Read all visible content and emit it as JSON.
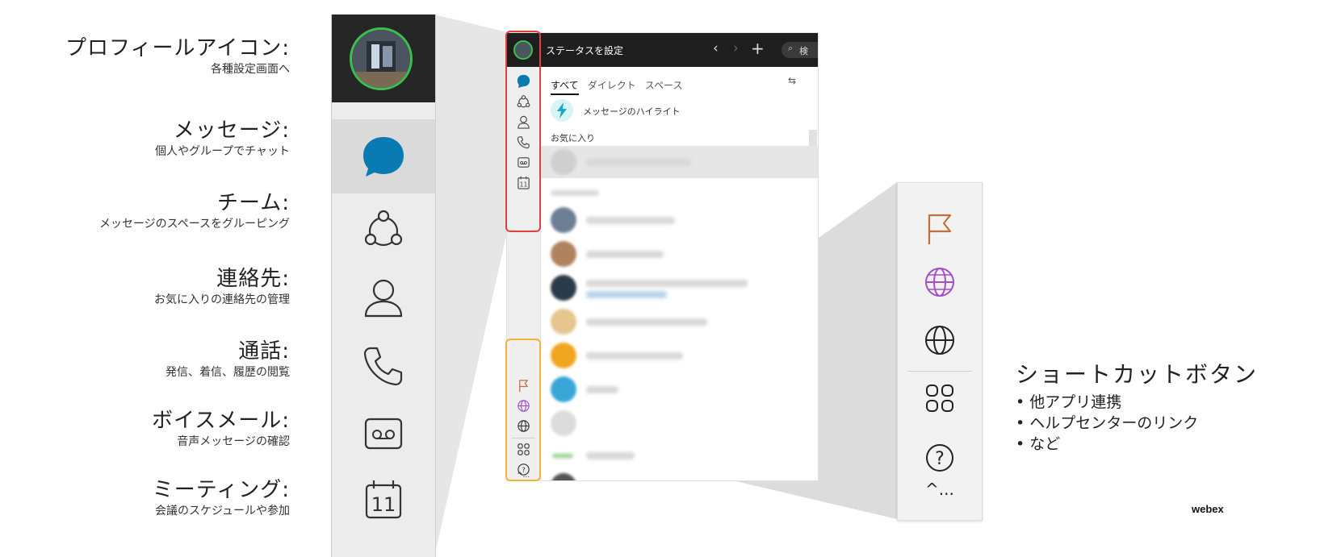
{
  "labels": [
    {
      "title": "プロフィールアイコン:",
      "sub": "各種設定画面へ"
    },
    {
      "title": "メッセージ:",
      "sub": "個人やグループでチャット"
    },
    {
      "title": "チーム:",
      "sub": "メッセージのスペースをグルーピング"
    },
    {
      "title": "連絡先:",
      "sub": "お気に入りの連絡先の管理"
    },
    {
      "title": "通話:",
      "sub": "発信、着信、履歴の閲覧"
    },
    {
      "title": "ボイスメール:",
      "sub": "音声メッセージの確認"
    },
    {
      "title": "ミーティング:",
      "sub": "会議のスケジュールや参加"
    }
  ],
  "app": {
    "status_label": "ステータスを設定",
    "search_label": "検",
    "tabs": [
      "すべて",
      "ダイレクト",
      "スペース"
    ],
    "highlight_label": "メッセージのハイライト",
    "favorites_label": "お気に入り",
    "calendar_day": "11",
    "more_label": "^..."
  },
  "shortcut": {
    "title": "ショートカットボタン",
    "items": [
      "• 他アプリ連携",
      "• ヘルプセンターのリンク",
      "• など"
    ],
    "more_label": "^..."
  },
  "brand": "webex",
  "colors": {
    "message_blue": "#0a7bb2",
    "flag": "#c2703a",
    "globe_purple": "#a24fc7",
    "red_outline": "#e0413a",
    "orange_outline": "#f2b233",
    "avatar_ring": "#3bbf4e"
  }
}
